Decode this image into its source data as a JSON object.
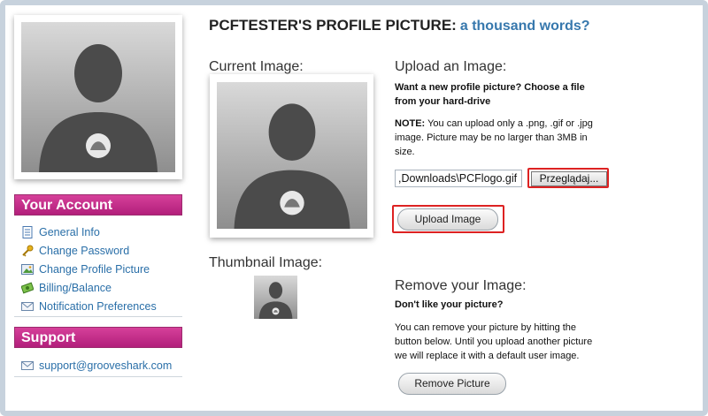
{
  "sidebar": {
    "account_heading": "Your Account",
    "account_items": [
      {
        "label": "General Info",
        "icon": "document-icon"
      },
      {
        "label": "Change Password",
        "icon": "key-icon"
      },
      {
        "label": "Change Profile Picture",
        "icon": "picture-icon"
      },
      {
        "label": "Billing/Balance",
        "icon": "money-icon"
      },
      {
        "label": "Notification Preferences",
        "icon": "envelope-icon"
      }
    ],
    "support_heading": "Support",
    "support_items": [
      {
        "label": "support@grooveshark.com",
        "icon": "envelope-icon"
      }
    ]
  },
  "header": {
    "title": "PCFTESTER'S PROFILE PICTURE:",
    "subtitle": "a thousand words?"
  },
  "current": {
    "heading": "Current Image:"
  },
  "thumbnail": {
    "heading": "Thumbnail Image:"
  },
  "upload": {
    "heading": "Upload an Image:",
    "intro": "Want a new profile picture? Choose a file from your hard-drive",
    "note_label": "NOTE:",
    "note_text": " You can upload only a .png, .gif or .jpg image. Picture may be no larger than 3MB in size.",
    "file_value": ",Downloads\\PCFlogo.gif",
    "browse_label": "Przeglądaj...",
    "button_label": "Upload Image"
  },
  "remove": {
    "heading": "Remove your Image:",
    "question": "Don't like your picture?",
    "text": "You can remove your picture by hitting the button below. Until you upload another picture we will replace it with a default user image.",
    "button_label": "Remove Picture"
  },
  "colors": {
    "accent_magenta": "#c02a86",
    "link_blue": "#2a6fa8",
    "highlight_red": "#dd2222"
  }
}
